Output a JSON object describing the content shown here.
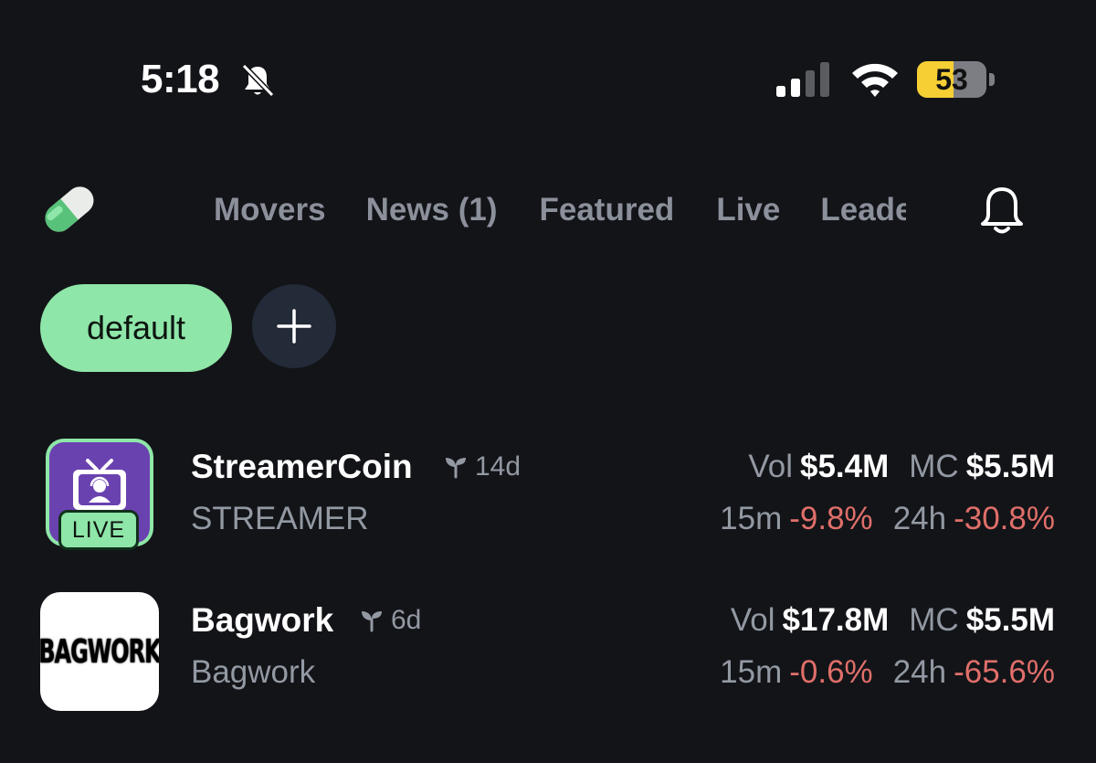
{
  "status_bar": {
    "time": "5:18",
    "battery": "53",
    "battery_level": 0.53
  },
  "nav": {
    "tabs": [
      "Movers",
      "News (1)",
      "Featured",
      "Live",
      "Leaderboard"
    ],
    "logo_icon": "pill-icon",
    "bell_icon": "bell-icon"
  },
  "watchlists": {
    "active": "default",
    "add_icon": "plus-icon"
  },
  "coins": [
    {
      "name": "StreamerCoin",
      "age": "14d",
      "ticker": "STREAMER",
      "badge": "LIVE",
      "vol_label": "Vol",
      "vol": "$5.4M",
      "mc_label": "MC",
      "mc": "$5.5M",
      "m15_label": "15m",
      "m15": "-9.8%",
      "h24_label": "24h",
      "h24": "-30.8%"
    },
    {
      "name": "Bagwork",
      "age": "6d",
      "ticker": "Bagwork",
      "logo_text": "BAGWORK",
      "vol_label": "Vol",
      "vol": "$17.8M",
      "mc_label": "MC",
      "mc": "$5.5M",
      "m15_label": "15m",
      "m15": "-0.6%",
      "h24_label": "24h",
      "h24": "-65.6%"
    }
  ],
  "colors": {
    "background": "#131418",
    "accent_green": "#8ee6a8",
    "negative": "#e06f6a",
    "muted": "#9399a3"
  }
}
